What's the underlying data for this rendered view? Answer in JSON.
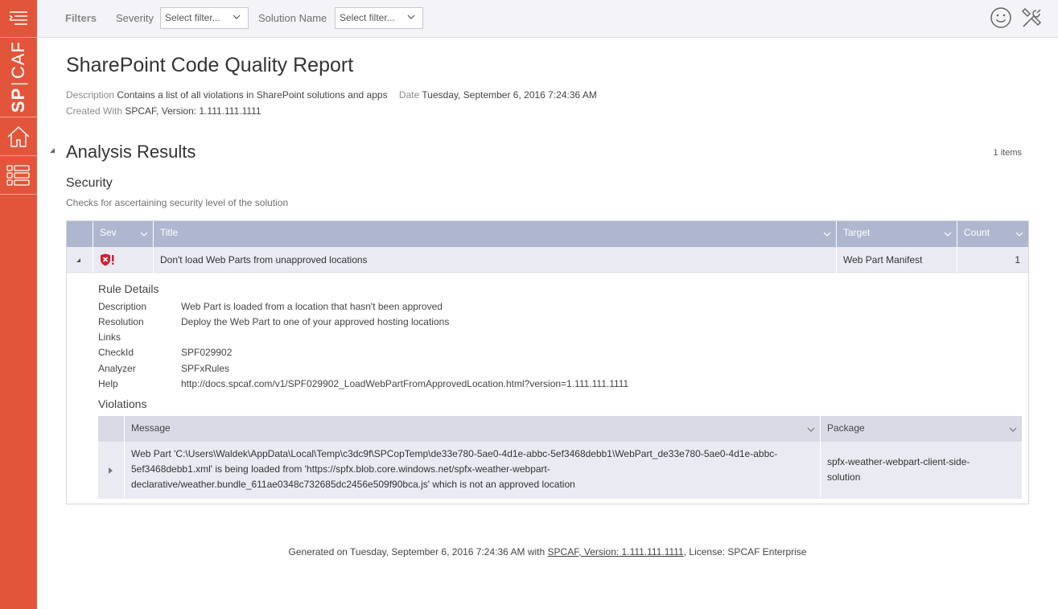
{
  "brand": {
    "bold": "SP",
    "thin": "CAF"
  },
  "filters": {
    "label": "Filters",
    "severity": {
      "label": "Severity",
      "placeholder": "Select filter..."
    },
    "solution_name": {
      "label": "Solution Name",
      "placeholder": "Select filter..."
    }
  },
  "report": {
    "title": "SharePoint Code Quality Report",
    "description_label": "Description",
    "description": "Contains a list of all violations in SharePoint solutions and apps",
    "date_label": "Date",
    "date": "Tuesday, September 6, 2016 7:24:36 AM",
    "created_label": "Created With",
    "created": "SPCAF, Version: 1.111.111.1111"
  },
  "analysis": {
    "title": "Analysis Results",
    "items_count": "1 items",
    "category": {
      "title": "Security",
      "description": "Checks for ascertaining security level of the solution",
      "columns": [
        "Sev",
        "Title",
        "Target",
        "Count"
      ],
      "rows": [
        {
          "severity": "critical-error",
          "title": "Don't load Web Parts from unapproved locations",
          "target": "Web Part Manifest",
          "count": "1",
          "rule_details_title": "Rule Details",
          "details": [
            {
              "key": "Description",
              "value": "Web Part is loaded from a location that hasn't been approved"
            },
            {
              "key": "Resolution",
              "value": "Deploy the Web Part to one of your approved hosting locations"
            },
            {
              "key": "Links",
              "value": ""
            },
            {
              "key": "CheckId",
              "value": "SPF029902"
            },
            {
              "key": "Analyzer",
              "value": "SPFxRules"
            },
            {
              "key": "Help",
              "value": "http://docs.spcaf.com/v1/SPF029902_LoadWebPartFromApprovedLocation.html?version=1.111.111.1111"
            }
          ],
          "violations_title": "Violations",
          "violation_columns": [
            "Message",
            "Package"
          ],
          "violations": [
            {
              "message_lines": [
                "Web Part 'C:\\Users\\Waldek\\AppData\\Local\\Temp\\c3dc9f\\SPCopTemp\\de33e780-5ae0-4d1e-abbc-5ef3468debb1\\WebPart_de33e780-5ae0-4d1e-abbc-",
                "5ef3468debb1.xml' is being loaded from 'https://spfx.blob.core.windows.net/spfx-weather-webpart-",
                "declarative/weather.bundle_611ae0348c732685dc2456e509f90bca.js' which is not an approved location"
              ],
              "package_lines": [
                "spfx-weather-webpart-client-side-",
                "solution"
              ]
            }
          ]
        }
      ]
    }
  },
  "footer": {
    "prefix": "Generated on Tuesday, September 6, 2016 7:24:36 AM with ",
    "link": "SPCAF, Version: 1.111.111.1111",
    "suffix": ", License: SPCAF Enterprise"
  },
  "icons": [
    "hamburger-menu-icon",
    "home-icon",
    "list-grid-icon",
    "smiley-feedback-icon",
    "tools-icon",
    "chevron-down-icon",
    "critical-error-icon",
    "expand-triangle-icon"
  ],
  "colors": {
    "rail": "#e2553a",
    "header_blue": "#afb6cf",
    "row_bg": "#eaebf2",
    "inner_header": "#d9dae5",
    "error_red": "#d0202e"
  }
}
